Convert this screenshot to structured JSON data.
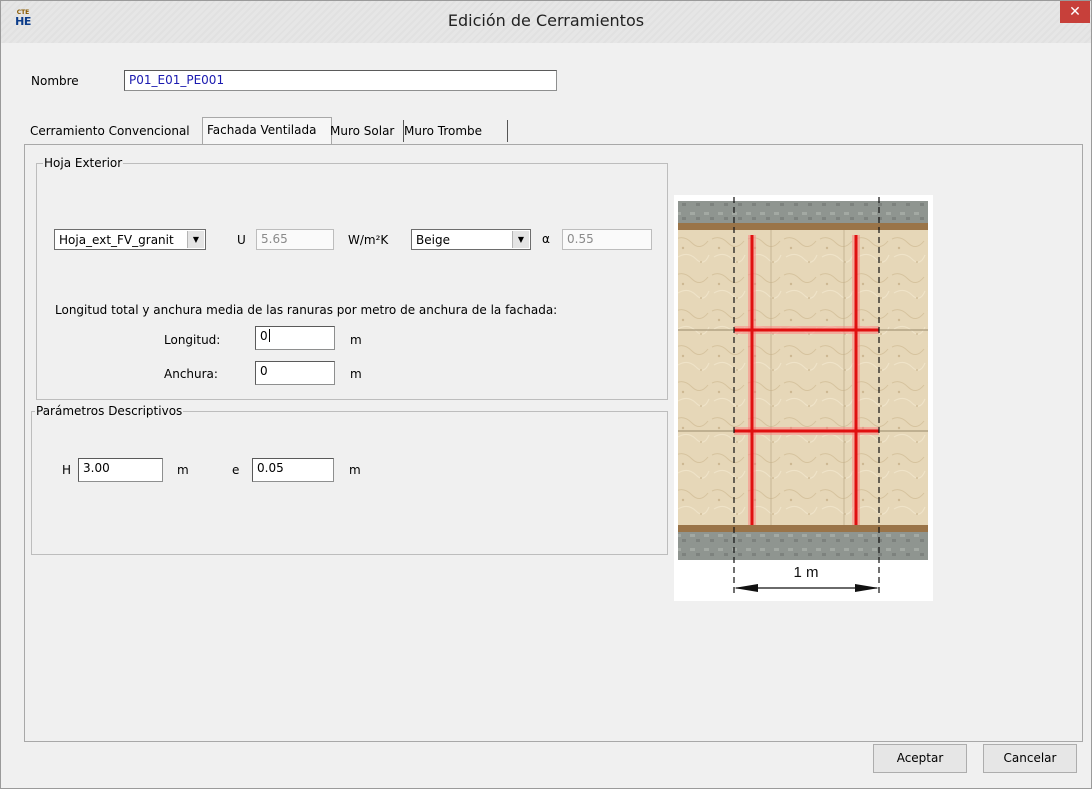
{
  "window": {
    "title": "Edición de Cerramientos",
    "icon_top": "CTE",
    "icon_main": "HE",
    "close_glyph": "✕"
  },
  "nombre": {
    "label": "Nombre",
    "value": "P01_E01_PE001"
  },
  "tabs": [
    {
      "label": "Cerramiento Convencional",
      "active": false
    },
    {
      "label": "Fachada Ventilada",
      "active": true
    },
    {
      "label": "Muro Solar",
      "active": false
    },
    {
      "label": "Muro Trombe",
      "active": false
    }
  ],
  "hoja_exterior": {
    "title": "Hoja Exterior",
    "material": "Hoja_ext_FV_granit",
    "u_label": "U",
    "u_value": "5.65",
    "u_unit": "W/m²K",
    "color": "Beige",
    "alpha_label": "α",
    "alpha_value": "0.55",
    "ranuras_text": "Longitud total y anchura media de las ranuras por metro de anchura de la fachada:",
    "longitud_label": "Longitud:",
    "longitud_value": "0",
    "anchura_label": "Anchura:",
    "anchura_value": "0",
    "unit_m": "m"
  },
  "parametros": {
    "title": "Parámetros Descriptivos",
    "h_label": "H",
    "h_value": "3.00",
    "e_label": "e",
    "e_value": "0.05",
    "unit_m": "m"
  },
  "illustration": {
    "dimension_label": "1 m"
  },
  "buttons": {
    "accept": "Aceptar",
    "cancel": "Cancelar"
  },
  "colors": {
    "slot_red": "#e01010",
    "close_red": "#c7403a",
    "tile": "#e6d7b8"
  }
}
